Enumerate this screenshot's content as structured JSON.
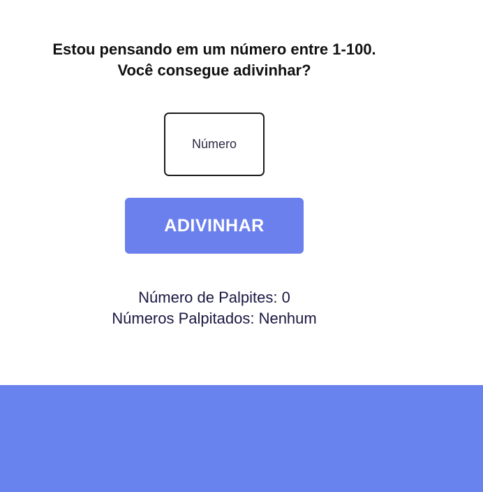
{
  "prompt": {
    "line1": "Estou pensando em um número entre 1-100.",
    "line2": "Você consegue adivinhar?"
  },
  "guess_input": {
    "placeholder": "Número",
    "value": ""
  },
  "guess_button": {
    "label": "ADIVINHAR"
  },
  "stats": {
    "guess_count_label": "Número de Palpites: 0",
    "guessed_numbers_label": "Números Palpitados: Nenhum"
  },
  "colors": {
    "accent": "#6b80ec",
    "footer": "#6882ee",
    "text": "#14122e"
  }
}
